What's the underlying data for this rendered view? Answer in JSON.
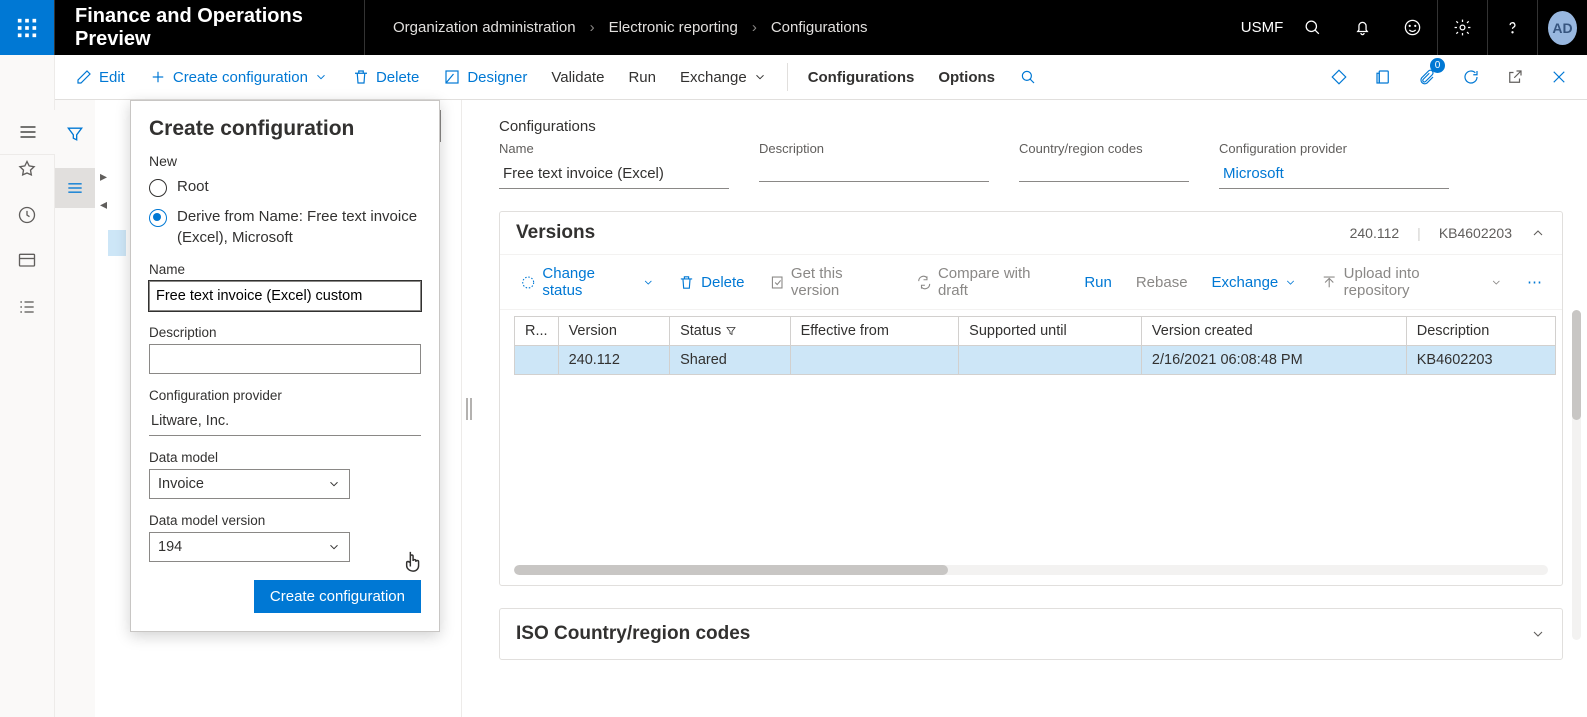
{
  "topbar": {
    "appTitle": "Finance and Operations Preview",
    "breadcrumbs": [
      "Organization administration",
      "Electronic reporting",
      "Configurations"
    ],
    "company": "USMF",
    "avatar": "AD",
    "badge": "0"
  },
  "commandbar": {
    "edit": "Edit",
    "createConfig": "Create configuration",
    "delete": "Delete",
    "designer": "Designer",
    "validate": "Validate",
    "run": "Run",
    "exchange": "Exchange",
    "configurations": "Configurations",
    "options": "Options"
  },
  "dropdown": {
    "title": "Create configuration",
    "sectionNew": "New",
    "radioRoot": "Root",
    "radioDerive": "Derive from Name: Free text invoice (Excel), Microsoft",
    "fields": {
      "nameLabel": "Name",
      "name": "Free text invoice (Excel) custom",
      "descriptionLabel": "Description",
      "description": "",
      "providerLabel": "Configuration provider",
      "provider": "Litware, Inc.",
      "dataModelLabel": "Data model",
      "dataModel": "Invoice",
      "dataModelVersionLabel": "Data model version",
      "dataModelVersion": "194"
    },
    "submit": "Create configuration"
  },
  "detail": {
    "header": "Configurations",
    "fields": {
      "nameLabel": "Name",
      "name": "Free text invoice (Excel)",
      "descriptionLabel": "Description",
      "description": "",
      "countryLabel": "Country/region codes",
      "country": "",
      "providerLabel": "Configuration provider",
      "provider": "Microsoft"
    }
  },
  "versions": {
    "title": "Versions",
    "summaryVersion": "240.112",
    "summaryKb": "KB4602203",
    "toolbar": {
      "changeStatus": "Change status",
      "delete": "Delete",
      "getVersion": "Get this version",
      "compare": "Compare with draft",
      "run": "Run",
      "rebase": "Rebase",
      "exchange": "Exchange",
      "upload": "Upload into repository"
    },
    "columns": {
      "r": "R...",
      "version": "Version",
      "status": "Status",
      "effective": "Effective from",
      "supported": "Supported until",
      "created": "Version created",
      "description": "Description"
    },
    "rows": [
      {
        "version": "240.112",
        "status": "Shared",
        "effective": "",
        "supported": "",
        "created": "2/16/2021 06:08:48 PM",
        "description": "KB4602203"
      }
    ]
  },
  "iso": {
    "title": "ISO Country/region codes"
  }
}
